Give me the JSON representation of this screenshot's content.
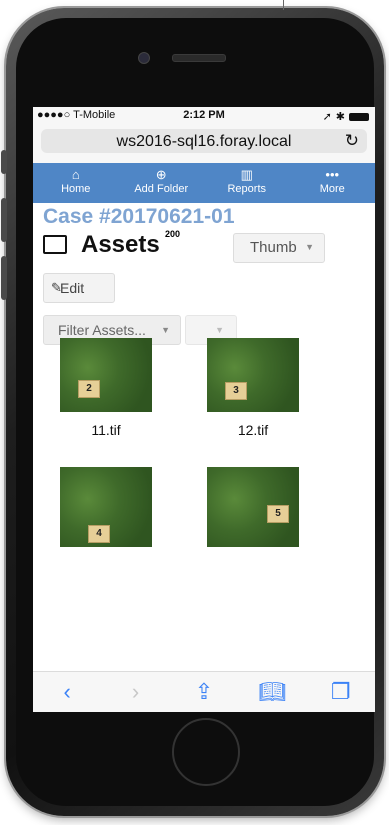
{
  "status_bar": {
    "carrier": "●●●●○ T-Mobile",
    "time": "2:12 PM",
    "location_icon": "location-arrow-icon",
    "bluetooth_icon": "bluetooth-icon"
  },
  "browser": {
    "url": "ws2016-sql16.foray.local",
    "reload_icon": "reload-icon"
  },
  "nav": {
    "items": [
      {
        "label": "Home",
        "icon": "home-icon",
        "glyph": "⌂"
      },
      {
        "label": "Add Folder",
        "icon": "plus-circle-icon",
        "glyph": "⊕"
      },
      {
        "label": "Reports",
        "icon": "bar-chart-icon",
        "glyph": "▥"
      },
      {
        "label": "More",
        "icon": "ellipsis-icon",
        "glyph": "•••"
      }
    ],
    "background_color": "#4f86c6"
  },
  "page": {
    "case_title": "Case #20170621-01",
    "assets_title": "Assets",
    "assets_count": "200",
    "view_select": "Thumb",
    "edit_label": "Edit",
    "filter_placeholder": "Filter Assets...",
    "accent_color": "#7fa4d2"
  },
  "assets": [
    {
      "filename": "11.tif",
      "marker": "2"
    },
    {
      "filename": "12.tif",
      "marker": "3"
    },
    {
      "filename": "",
      "marker": "4"
    },
    {
      "filename": "",
      "marker": "5"
    }
  ],
  "toolbar": {
    "back_icon": "back-chevron-icon",
    "forward_icon": "forward-chevron-icon",
    "share_icon": "share-icon",
    "bookmarks_icon": "bookmarks-icon",
    "tabs_icon": "tabs-icon"
  }
}
